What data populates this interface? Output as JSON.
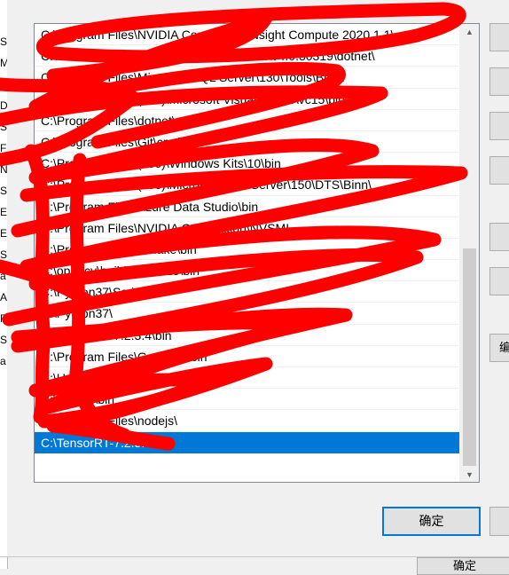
{
  "background_window": {
    "fragments": [
      "S",
      "M",
      "M",
      "D",
      "S",
      "F",
      "N",
      "S",
      "E",
      "E",
      "S",
      "a",
      "A",
      "R",
      "S",
      "a"
    ]
  },
  "path_list": {
    "rows": [
      "C:\\Program Files\\NVIDIA Corporation\\Nsight Compute 2020.1.1\\",
      "C:\\Windows\\Microsoft.NET\\Framework64\\v4.0.30319\\dotnet\\",
      "C:\\Program Files\\Microsoft SQL Server\\130\\Tools\\Binn\\",
      "C:\\Program Files (x86)\\Microsoft Visual Studio\\vc15\\bin",
      "C:\\Program Files\\dotnet\\",
      "C:\\Program Files\\Git\\cmd",
      "C:\\Program Files (x86)\\Windows Kits\\10\\bin",
      "C:\\Program Files (x86)\\Microsoft SQL Server\\150\\DTS\\Binn\\",
      "C:\\Program Files\\Azure Data Studio\\bin",
      "C:\\Program Files\\NVIDIA Corporation\\NVSMI",
      "C:\\Program Files\\CMake\\bin",
      "C:\\opencv\\build\\x64\\vc15\\bin",
      "C:\\Python37\\Scripts\\",
      "C:\\Python37\\",
      "C:\\TensorRT-7.2.3.4\\bin",
      "C:\\Program Files\\Graphviz\\bin",
      "C:\\Users\\admin\\AppData\\bin",
      "C:\\ffmpeg\\bin",
      "C:\\Program Files\\nodejs\\",
      "C:\\TensorRT-7.2.3.4\\lib"
    ],
    "selected_index": 19
  },
  "side_buttons": {
    "new": "",
    "edit": "",
    "browse": "",
    "delete": "",
    "move_up": "",
    "move_down": "",
    "edit_text": "编"
  },
  "footer": {
    "ok_label": "确定",
    "cancel_label": "",
    "taskbar_label": "确定"
  },
  "colors": {
    "selection": "#0078d7",
    "scribble": "#ff0000"
  }
}
